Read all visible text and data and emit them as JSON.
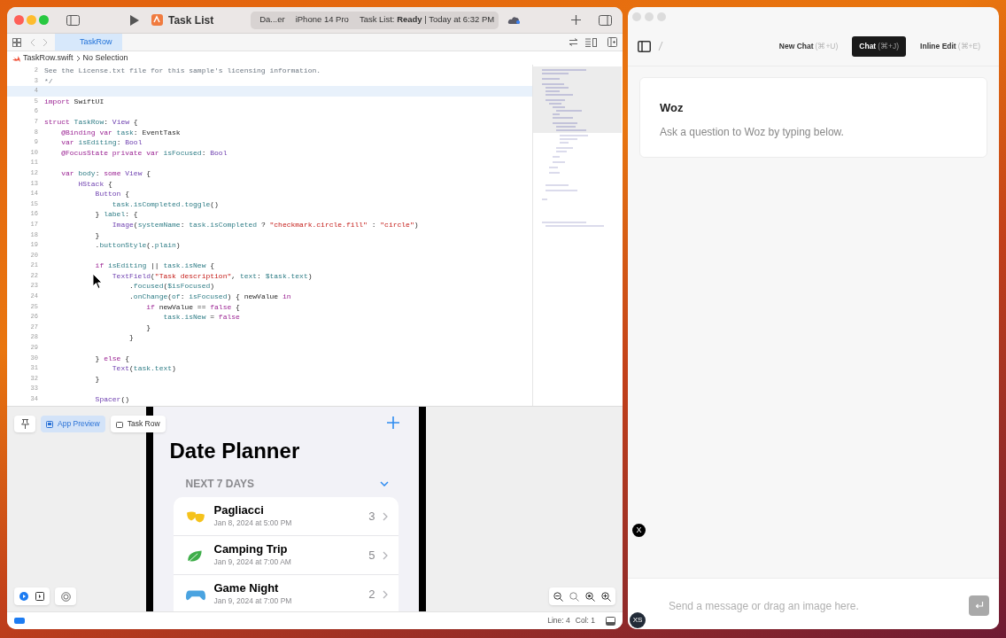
{
  "xcode": {
    "toolbar": {
      "scheme_name": "Task List",
      "destination_project": "Da...er",
      "destination_device": "iPhone 14 Pro",
      "status": "Task List: **Ready** | Today at 6:32 PM"
    },
    "tabs": [
      {
        "label": "TaskRow",
        "selected": true
      }
    ],
    "jump_bar": {
      "file": "TaskRow.swift",
      "selection": "No Selection"
    },
    "editor": {
      "lines": [
        {
          "number": "2",
          "current": false,
          "tokens": [
            {
              "kind": "comment",
              "text": "See the License.txt file for this sample's licensing information."
            }
          ]
        },
        {
          "number": "3",
          "current": false,
          "tokens": [
            {
              "kind": "comment",
              "text": "*/"
            }
          ]
        },
        {
          "number": "4",
          "current": true
        },
        {
          "number": "5",
          "current": false,
          "tokens": [
            {
              "kind": "keyword",
              "text": "import"
            },
            {
              "kind": "plain",
              "text": " SwiftUI"
            }
          ]
        },
        {
          "number": "6",
          "current": false
        },
        {
          "number": "7",
          "current": false,
          "tokens": [
            {
              "kind": "keyword",
              "text": "struct"
            },
            {
              "kind": "ident",
              "text": " TaskRow"
            },
            {
              "kind": "plain",
              "text": ": "
            },
            {
              "kind": "type",
              "text": "View"
            },
            {
              "kind": "plain",
              "text": " {"
            }
          ]
        },
        {
          "number": "8",
          "current": false,
          "tokens": [
            {
              "kind": "keyword",
              "text": "    @Binding var"
            },
            {
              "kind": "ident",
              "text": " task"
            },
            {
              "kind": "plain",
              "text": ": EventTask"
            }
          ]
        },
        {
          "number": "9",
          "current": false,
          "tokens": [
            {
              "kind": "keyword",
              "text": "    var"
            },
            {
              "kind": "ident",
              "text": " isEditing"
            },
            {
              "kind": "plain",
              "text": ": "
            },
            {
              "kind": "type",
              "text": "Bool"
            }
          ]
        },
        {
          "number": "10",
          "current": false,
          "tokens": [
            {
              "kind": "keyword",
              "text": "    @FocusState private var"
            },
            {
              "kind": "ident",
              "text": " isFocused"
            },
            {
              "kind": "plain",
              "text": ": "
            },
            {
              "kind": "type",
              "text": "Bool"
            }
          ]
        },
        {
          "number": "11",
          "current": false
        },
        {
          "number": "12",
          "current": false,
          "tokens": [
            {
              "kind": "keyword",
              "text": "    var"
            },
            {
              "kind": "ident",
              "text": " body"
            },
            {
              "kind": "plain",
              "text": ": "
            },
            {
              "kind": "keyword",
              "text": "some"
            },
            {
              "kind": "type",
              "text": " View"
            },
            {
              "kind": "plain",
              "text": " {"
            }
          ]
        },
        {
          "number": "13",
          "current": false,
          "tokens": [
            {
              "kind": "type",
              "text": "        HStack"
            },
            {
              "kind": "plain",
              "text": " {"
            }
          ]
        },
        {
          "number": "14",
          "current": false,
          "tokens": [
            {
              "kind": "type",
              "text": "            Button"
            },
            {
              "kind": "plain",
              "text": " {"
            }
          ]
        },
        {
          "number": "15",
          "current": false,
          "tokens": [
            {
              "kind": "ident",
              "text": "                task.isCompleted.toggle"
            },
            {
              "kind": "plain",
              "text": "()"
            }
          ]
        },
        {
          "number": "16",
          "current": false,
          "tokens": [
            {
              "kind": "plain",
              "text": "            } "
            },
            {
              "kind": "ident",
              "text": "label"
            },
            {
              "kind": "plain",
              "text": ": {"
            }
          ]
        },
        {
          "number": "17",
          "current": false,
          "tokens": [
            {
              "kind": "type",
              "text": "                Image"
            },
            {
              "kind": "plain",
              "text": "("
            },
            {
              "kind": "ident",
              "text": "systemName"
            },
            {
              "kind": "plain",
              "text": ": "
            },
            {
              "kind": "ident",
              "text": "task.isCompleted"
            },
            {
              "kind": "plain",
              "text": " ? "
            },
            {
              "kind": "string",
              "text": "\"checkmark.circle.fill\""
            },
            {
              "kind": "plain",
              "text": " : "
            },
            {
              "kind": "string",
              "text": "\"circle\""
            },
            {
              "kind": "plain",
              "text": ")"
            }
          ]
        },
        {
          "number": "18",
          "current": false,
          "tokens": [
            {
              "kind": "plain",
              "text": "            }"
            }
          ]
        },
        {
          "number": "19",
          "current": false,
          "tokens": [
            {
              "kind": "plain",
              "text": "            ."
            },
            {
              "kind": "ident",
              "text": "buttonStyle"
            },
            {
              "kind": "plain",
              "text": "(."
            },
            {
              "kind": "ident",
              "text": "plain"
            },
            {
              "kind": "plain",
              "text": ")"
            }
          ]
        },
        {
          "number": "20",
          "current": false
        },
        {
          "number": "21",
          "current": false,
          "tokens": [
            {
              "kind": "keyword",
              "text": "            if"
            },
            {
              "kind": "ident",
              "text": " isEditing"
            },
            {
              "kind": "plain",
              "text": " || "
            },
            {
              "kind": "ident",
              "text": "task.isNew"
            },
            {
              "kind": "plain",
              "text": " {"
            }
          ]
        },
        {
          "number": "22",
          "current": false,
          "tokens": [
            {
              "kind": "type",
              "text": "                TextField"
            },
            {
              "kind": "plain",
              "text": "("
            },
            {
              "kind": "string",
              "text": "\"Task description\""
            },
            {
              "kind": "plain",
              "text": ", "
            },
            {
              "kind": "ident",
              "text": "text"
            },
            {
              "kind": "plain",
              "text": ": "
            },
            {
              "kind": "ident",
              "text": "$task.text"
            },
            {
              "kind": "plain",
              "text": ")"
            }
          ]
        },
        {
          "number": "23",
          "current": false,
          "tokens": [
            {
              "kind": "plain",
              "text": "                    ."
            },
            {
              "kind": "ident",
              "text": "focused"
            },
            {
              "kind": "plain",
              "text": "("
            },
            {
              "kind": "ident",
              "text": "$isFocused"
            },
            {
              "kind": "plain",
              "text": ")"
            }
          ]
        },
        {
          "number": "24",
          "current": false,
          "tokens": [
            {
              "kind": "plain",
              "text": "                    ."
            },
            {
              "kind": "ident",
              "text": "onChange"
            },
            {
              "kind": "plain",
              "text": "("
            },
            {
              "kind": "ident",
              "text": "of"
            },
            {
              "kind": "plain",
              "text": ": "
            },
            {
              "kind": "ident",
              "text": "isFocused"
            },
            {
              "kind": "plain",
              "text": ") { newValue "
            },
            {
              "kind": "keyword",
              "text": "in"
            }
          ]
        },
        {
          "number": "25",
          "current": false,
          "tokens": [
            {
              "kind": "keyword",
              "text": "                        if"
            },
            {
              "kind": "plain",
              "text": " newValue == "
            },
            {
              "kind": "keyword",
              "text": "false"
            },
            {
              "kind": "plain",
              "text": " {"
            }
          ]
        },
        {
          "number": "26",
          "current": false,
          "tokens": [
            {
              "kind": "ident",
              "text": "                            task.isNew"
            },
            {
              "kind": "plain",
              "text": " = "
            },
            {
              "kind": "keyword",
              "text": "false"
            }
          ]
        },
        {
          "number": "27",
          "current": false,
          "tokens": [
            {
              "kind": "plain",
              "text": "                        }"
            }
          ]
        },
        {
          "number": "28",
          "current": false,
          "tokens": [
            {
              "kind": "plain",
              "text": "                    }"
            }
          ]
        },
        {
          "number": "29",
          "current": false
        },
        {
          "number": "30",
          "current": false,
          "tokens": [
            {
              "kind": "plain",
              "text": "            } "
            },
            {
              "kind": "keyword",
              "text": "else"
            },
            {
              "kind": "plain",
              "text": " {"
            }
          ]
        },
        {
          "number": "31",
          "current": false,
          "tokens": [
            {
              "kind": "type",
              "text": "                Text"
            },
            {
              "kind": "plain",
              "text": "("
            },
            {
              "kind": "ident",
              "text": "task.text"
            },
            {
              "kind": "plain",
              "text": ")"
            }
          ]
        },
        {
          "number": "32",
          "current": false,
          "tokens": [
            {
              "kind": "plain",
              "text": "            }"
            }
          ]
        },
        {
          "number": "33",
          "current": false
        },
        {
          "number": "34",
          "current": false,
          "tokens": [
            {
              "kind": "type",
              "text": "            Spacer"
            },
            {
              "kind": "plain",
              "text": "()"
            }
          ]
        }
      ]
    },
    "preview": {
      "modes": [
        {
          "label": "App Preview",
          "selected": true
        },
        {
          "label": "Task Row",
          "selected": false
        }
      ],
      "app": {
        "title": "Date Planner",
        "section": "NEXT 7 DAYS",
        "events": [
          {
            "kind": "masks",
            "color": "#f5c21b",
            "title": "Pagliacci",
            "date": "Jan 8, 2024 at 5:00 PM",
            "count": "3"
          },
          {
            "kind": "leaf",
            "color": "#3fae4a",
            "title": "Camping Trip",
            "date": "Jan 9, 2024 at 7:00 AM",
            "count": "5"
          },
          {
            "kind": "controller",
            "color": "#4aa3e0",
            "title": "Game Night",
            "date": "Jan 9, 2024 at 7:00 PM",
            "count": "2"
          }
        ]
      }
    },
    "status_bar": {
      "line": "Line: 4",
      "column": "Col: 1"
    }
  },
  "woz": {
    "modes": [
      {
        "label": "New Chat",
        "shortcut": "(⌘+U)",
        "selected": false
      },
      {
        "label": "Chat",
        "shortcut": "(⌘+J)",
        "selected": true
      },
      {
        "label": "Inline Edit",
        "shortcut": "(⌘+E)",
        "selected": false
      }
    ],
    "card": {
      "title": "Woz",
      "subtitle": "Ask a question to Woz by typing below."
    },
    "bot_avatar": "X",
    "input": {
      "placeholder": "Send a message or drag an image here."
    },
    "user_avatar": "XS"
  }
}
